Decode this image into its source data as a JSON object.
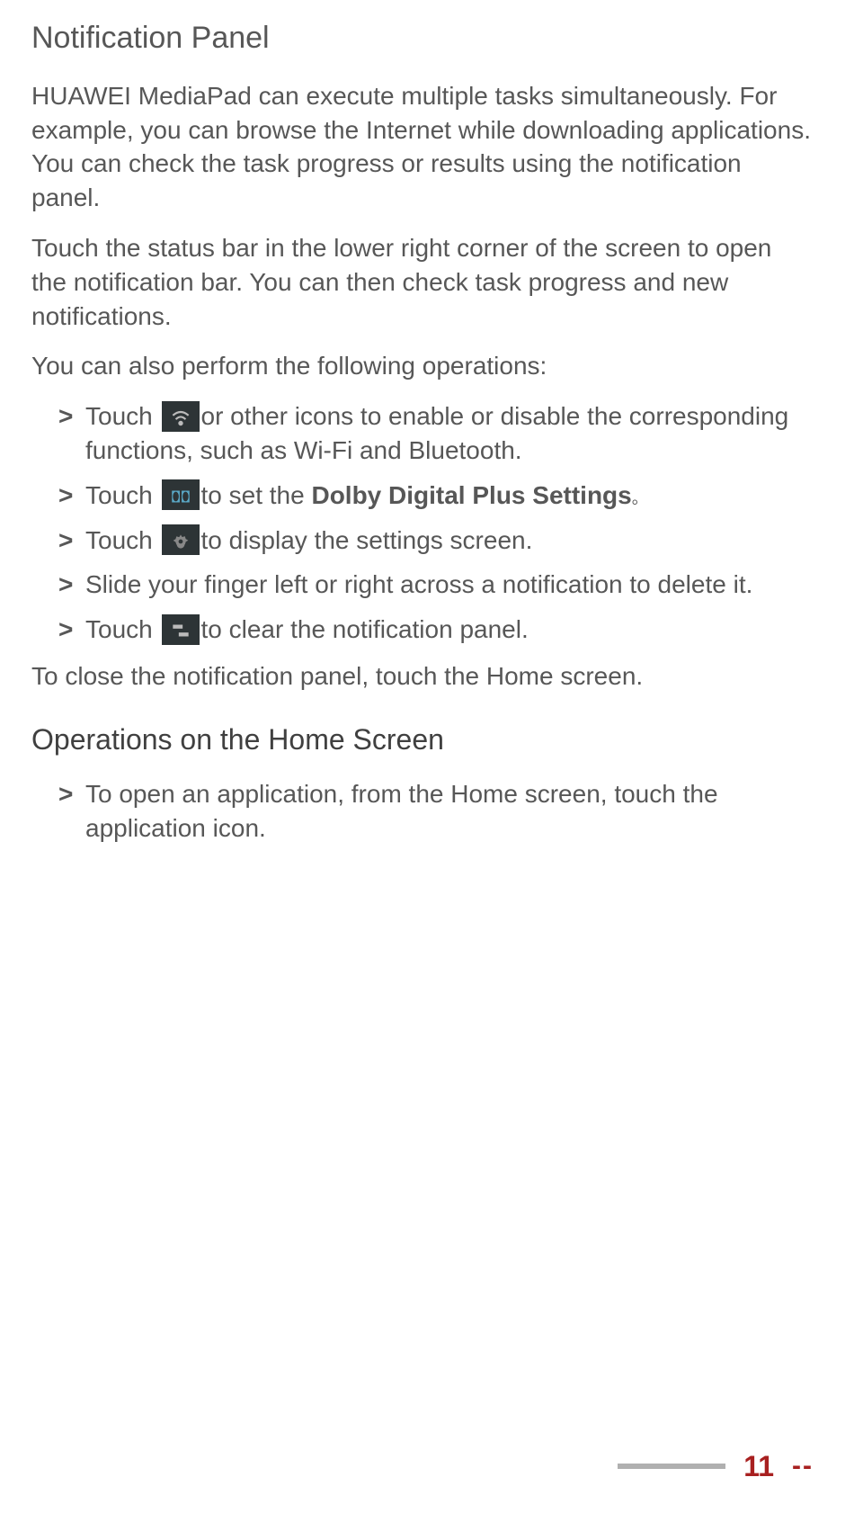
{
  "section1": {
    "title": "Notification Panel",
    "para1": "HUAWEI MediaPad can execute multiple tasks simultaneously. For example, you can browse the Internet while downloading applications. You can check the task progress or results using the notification panel.",
    "para2": "Touch the status bar in the lower right corner of the screen to open the notification bar. You can then check task progress and new notifications.",
    "para3": "You can also perform the following operations:",
    "bullets": {
      "b1_pre": "Touch ",
      "b1_post": "or other icons to enable or disable the corresponding functions, such as Wi-Fi and Bluetooth.",
      "b2_pre": "Touch ",
      "b2_post_a": "to set the ",
      "b2_bold": "Dolby Digital Plus Settings",
      "b3_pre": "Touch ",
      "b3_post": "to display the settings screen.",
      "b4": "Slide your finger left or right across a notification to delete it.",
      "b5_pre": "Touch ",
      "b5_post": "to clear the notification panel."
    },
    "closing": "To close the notification panel, touch the Home screen."
  },
  "section2": {
    "title": "Operations on the Home Screen",
    "bullets": {
      "b1": "To open an application, from the Home screen, touch the application icon."
    }
  },
  "footer": {
    "page": "11",
    "sep": "--"
  }
}
